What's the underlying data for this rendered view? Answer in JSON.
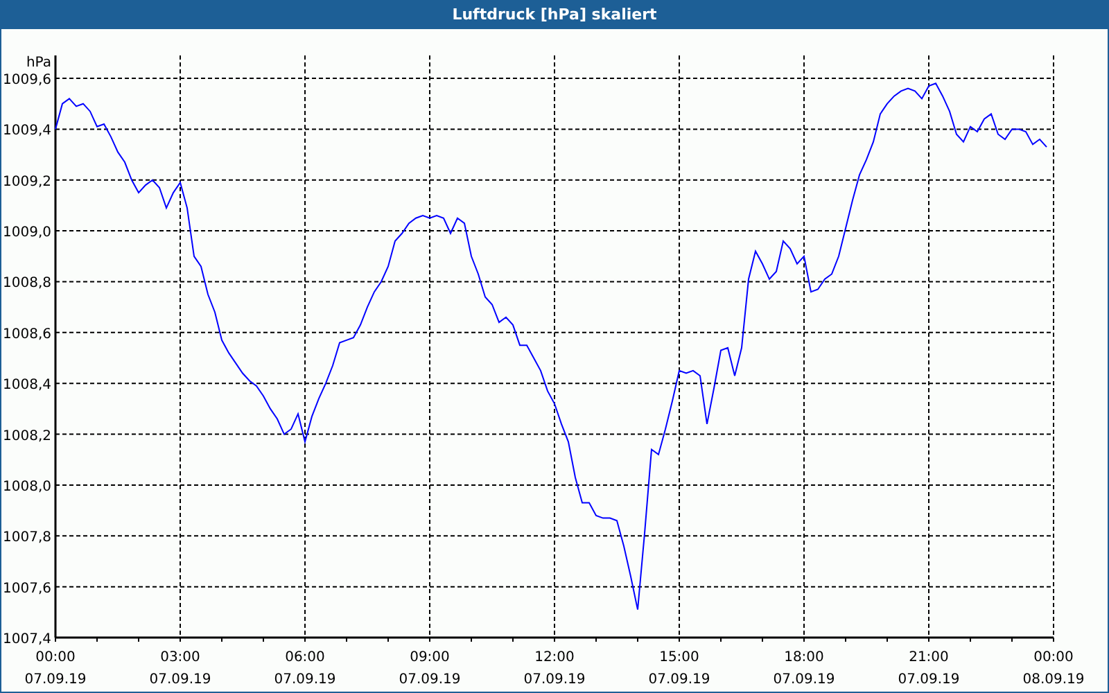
{
  "window": {
    "title": "Luftdruck [hPa] skaliert"
  },
  "chart": {
    "chart_data": {
      "type": "line",
      "grid": true,
      "ylabel": "hPa",
      "ylim": [
        1007.4,
        1009.69
      ],
      "categories": [
        "00:00\n07.09.19",
        null,
        null,
        null,
        null,
        null,
        null,
        null,
        null,
        null,
        null,
        null,
        null,
        null,
        null,
        null,
        null,
        null,
        "03:00\n07.09.19",
        null,
        null,
        null,
        null,
        null,
        null,
        null,
        null,
        null,
        null,
        null,
        null,
        null,
        null,
        null,
        null,
        null,
        "06:00\n07.09.19",
        null,
        null,
        null,
        null,
        null,
        null,
        null,
        null,
        null,
        null,
        null,
        null,
        null,
        null,
        null,
        null,
        null,
        "09:00\n07.09.19",
        null,
        null,
        null,
        null,
        null,
        null,
        null,
        null,
        null,
        null,
        null,
        null,
        null,
        null,
        null,
        null,
        null,
        "12:00\n07.09.19",
        null,
        null,
        null,
        null,
        null,
        null,
        null,
        null,
        null,
        null,
        null,
        null,
        null,
        null,
        null,
        null,
        null,
        "15:00\n07.09.19",
        null,
        null,
        null,
        null,
        null,
        null,
        null,
        null,
        null,
        null,
        null,
        null,
        null,
        null,
        null,
        null,
        null,
        "18:00\n07.09.19",
        null,
        null,
        null,
        null,
        null,
        null,
        null,
        null,
        null,
        null,
        null,
        null,
        null,
        null,
        null,
        null,
        null,
        "21:00\n07.09.19",
        null,
        null,
        null,
        null,
        null,
        null,
        null,
        null,
        null,
        null,
        null,
        null,
        null,
        null,
        null,
        null,
        null,
        "00:00\n08.09.19"
      ],
      "yticks": [
        {
          "value": 1007.4,
          "label": "1007,4"
        },
        {
          "value": 1007.6,
          "label": "1007,6"
        },
        {
          "value": 1007.8,
          "label": "1007,8"
        },
        {
          "value": 1008,
          "label": "1008,0"
        },
        {
          "value": 1008.2,
          "label": "1008,2"
        },
        {
          "value": 1008.4,
          "label": "1008,4"
        },
        {
          "value": 1008.6,
          "label": "1008,6"
        },
        {
          "value": 1008.8,
          "label": "1008,8"
        },
        {
          "value": 1009,
          "label": "1009,0"
        },
        {
          "value": 1009.2,
          "label": "1009,2"
        },
        {
          "value": 1009.4,
          "label": "1009,4"
        },
        {
          "value": 1009.6,
          "label": "1009,6"
        }
      ],
      "series": [
        {
          "color": "#0000ff",
          "values": [
            1009.4,
            1009.5,
            1009.52,
            1009.49,
            1009.5,
            1009.47,
            1009.41,
            1009.42,
            1009.37,
            1009.31,
            1009.27,
            1009.2,
            1009.15,
            1009.18,
            1009.2,
            1009.17,
            1009.09,
            1009.15,
            1009.19,
            1009.09,
            1008.9,
            1008.86,
            1008.75,
            1008.68,
            1008.57,
            1008.52,
            1008.48,
            1008.44,
            1008.41,
            1008.39,
            1008.35,
            1008.3,
            1008.26,
            1008.2,
            1008.22,
            1008.28,
            1008.17,
            1008.27,
            1008.34,
            1008.4,
            1008.47,
            1008.56,
            1008.57,
            1008.58,
            1008.63,
            1008.7,
            1008.76,
            1008.8,
            1008.86,
            1008.96,
            1008.99,
            1009.03,
            1009.05,
            1009.06,
            1009.05,
            1009.06,
            1009.05,
            1008.99,
            1009.05,
            1009.03,
            1008.9,
            1008.83,
            1008.74,
            1008.71,
            1008.64,
            1008.66,
            1008.63,
            1008.55,
            1008.55,
            1008.5,
            1008.45,
            1008.37,
            1008.32,
            1008.24,
            1008.17,
            1008.03,
            1007.93,
            1007.93,
            1007.88,
            1007.87,
            1007.87,
            1007.86,
            1007.76,
            1007.64,
            1007.51,
            1007.81,
            1008.14,
            1008.12,
            1008.22,
            1008.33,
            1008.45,
            1008.44,
            1008.45,
            1008.43,
            1008.24,
            1008.38,
            1008.53,
            1008.54,
            1008.43,
            1008.54,
            1008.81,
            1008.92,
            1008.87,
            1008.81,
            1008.84,
            1008.96,
            1008.93,
            1008.87,
            1008.9,
            1008.76,
            1008.77,
            1008.81,
            1008.83,
            1008.9,
            1009.01,
            1009.12,
            1009.22,
            1009.28,
            1009.35,
            1009.46,
            1009.5,
            1009.53,
            1009.55,
            1009.56,
            1009.55,
            1009.52,
            1009.57,
            1009.58,
            1009.53,
            1009.47,
            1009.38,
            1009.35,
            1009.41,
            1009.39,
            1009.44,
            1009.46,
            1009.38,
            1009.36,
            1009.4,
            1009.4,
            1009.39,
            1009.34,
            1009.36,
            1009.33,
            null
          ]
        }
      ]
    }
  }
}
